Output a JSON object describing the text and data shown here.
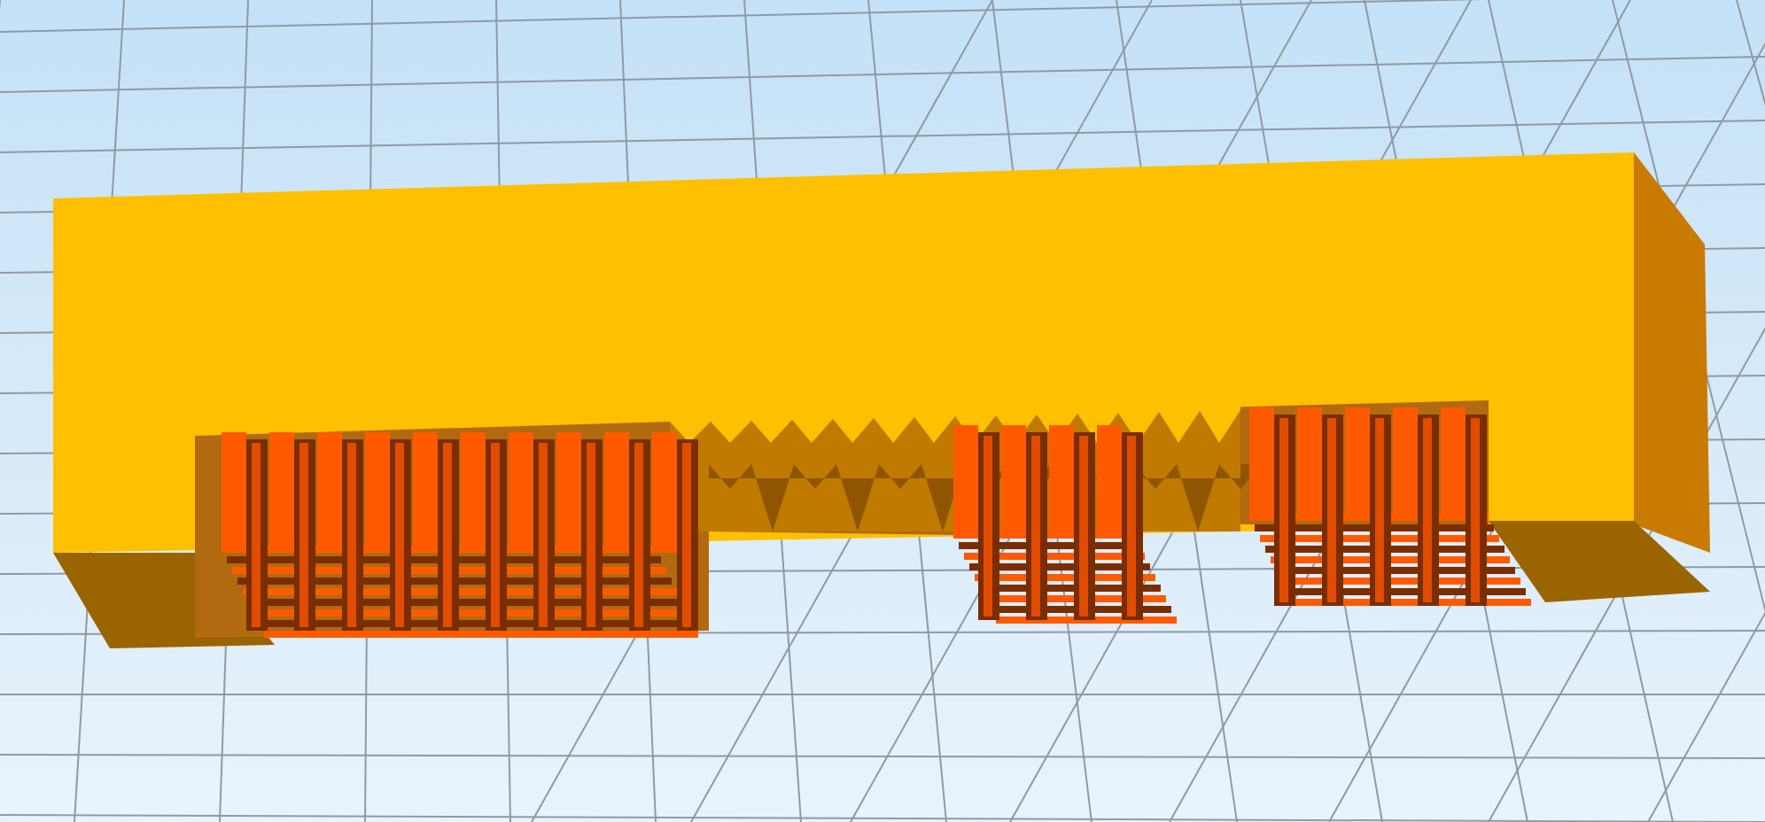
{
  "viewport": {
    "kind": "render"
  }
}
